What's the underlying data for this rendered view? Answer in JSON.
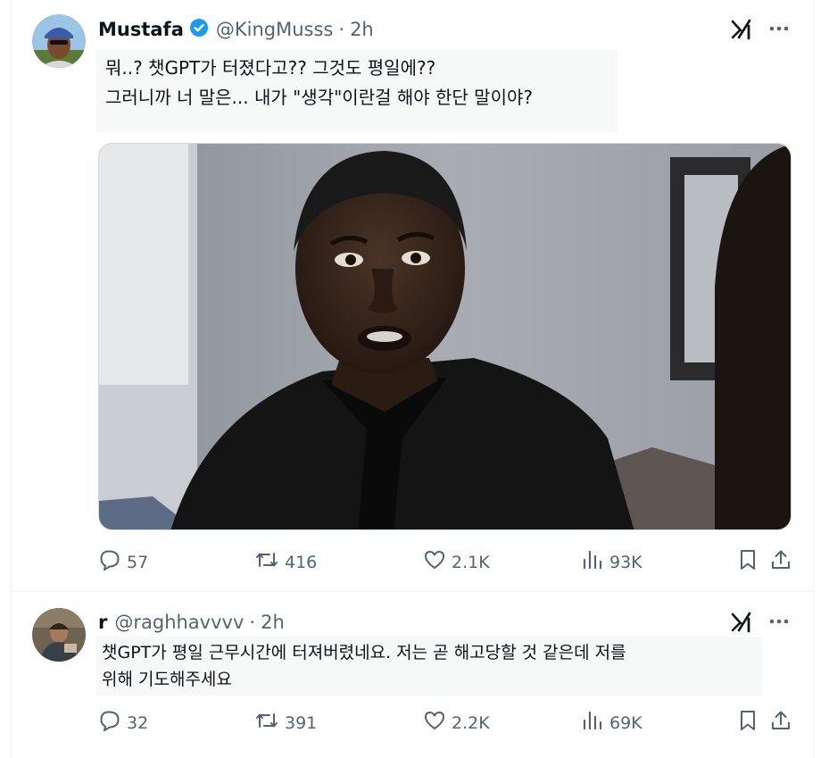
{
  "tweets": [
    {
      "author": {
        "name": "Mustafa",
        "handle": "@KingMusss",
        "time": "2h",
        "verified": true
      },
      "text_lines": [
        "뭐..? 챗GPT가 터졌다고?? 그것도 평일에??",
        "그러니까 너 말은... 내가 \"생각\"이란걸 해야 한단 말이야?"
      ],
      "stats": {
        "replies": "57",
        "reposts": "416",
        "likes": "2.1K",
        "views": "93K"
      }
    },
    {
      "author": {
        "name": "r",
        "handle": "@raghhavvvv",
        "time": "2h",
        "verified": false
      },
      "text_lines": [
        "챗GPT가 평일 근무시간에 터져버렸네요. 저는 곧 해고당할 것 같은데 저를",
        "위해 기도해주세요"
      ],
      "stats": {
        "replies": "32",
        "reposts": "391",
        "likes": "2.2K",
        "views": "69K"
      }
    }
  ],
  "colors": {
    "text": "#0f1419",
    "secondary": "#536471",
    "verified": "#1d9bf0",
    "divider": "#eff3f4"
  },
  "icons": [
    "verified-badge-icon",
    "grok-xai-icon",
    "more-icon",
    "reply-icon",
    "repost-icon",
    "like-icon",
    "views-icon",
    "bookmark-icon",
    "share-icon"
  ]
}
